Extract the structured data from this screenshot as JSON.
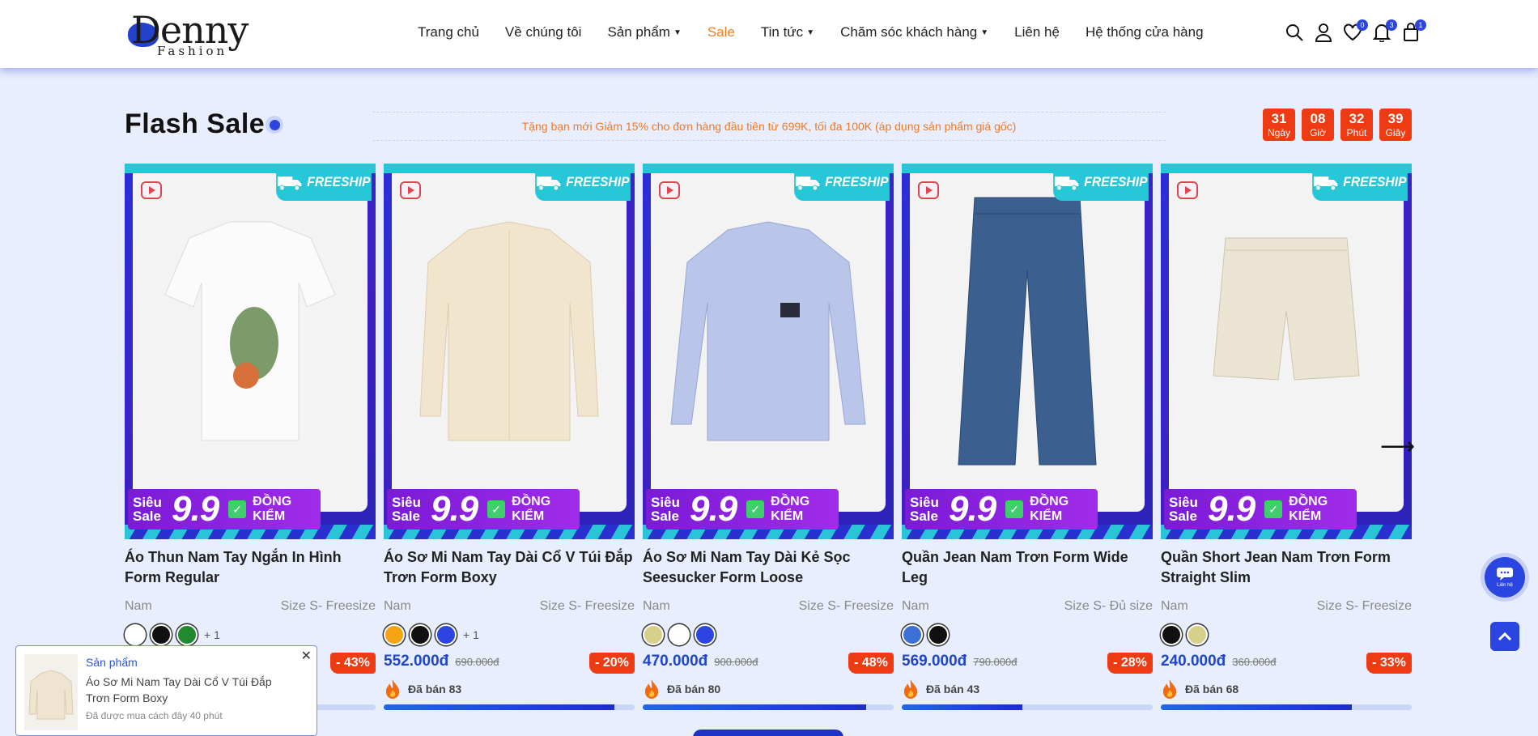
{
  "header": {
    "logo_text": "Denny",
    "logo_sub": "Fashion",
    "nav": [
      {
        "label": "Trang chủ",
        "caret": false
      },
      {
        "label": "Về chúng tôi",
        "caret": false
      },
      {
        "label": "Sản phẩm",
        "caret": true
      },
      {
        "label": "Sale",
        "caret": false
      },
      {
        "label": "Tin tức",
        "caret": true
      },
      {
        "label": "Chăm sóc khách hàng",
        "caret": true
      },
      {
        "label": "Liên hệ",
        "caret": false
      },
      {
        "label": "Hệ thống cửa hàng",
        "caret": false
      }
    ],
    "icons": {
      "search": "search-icon",
      "account": "user-icon",
      "wishlist": "heart-icon",
      "notifications": "bell-icon",
      "cart": "cart-icon"
    },
    "badges": {
      "wishlist": "0",
      "notifications": "3",
      "cart": "1"
    }
  },
  "flash_sale": {
    "title": "Flash Sale",
    "promo": "Tặng bạn mới Giảm 15% cho đơn hàng đầu tiên từ 699K, tối đa 100K (áp dụng sản phẩm giá gốc)",
    "countdown": [
      {
        "value": "31",
        "label": "Ngày"
      },
      {
        "value": "08",
        "label": "Giờ"
      },
      {
        "value": "32",
        "label": "Phút"
      },
      {
        "value": "39",
        "label": "Giây"
      }
    ]
  },
  "badge_texts": {
    "freeship": "FREESHIP",
    "sieu": "Siêu",
    "sale": "Sale",
    "num": "9.9",
    "dong": "ĐỒNG",
    "kiem": "KIỂM"
  },
  "products": [
    {
      "name": "Áo Thun Nam Tay Ngắn In Hình Form Regular",
      "gender": "Nam",
      "size": "Size S- Freesize",
      "colors": [
        "#ffffff",
        "#111111",
        "#1f8a2e"
      ],
      "more": "+ 1",
      "price": "",
      "old_price": "",
      "discount": "- 43%",
      "sold": "",
      "progress": 0.0
    },
    {
      "name": "Áo Sơ Mi Nam Tay Dài Cổ V Túi Đắp Trơn Form Boxy",
      "gender": "Nam",
      "size": "Size S- Freesize",
      "colors": [
        "#f5a313",
        "#111111",
        "#2d45e0"
      ],
      "more": "+ 1",
      "price": "552.000đ",
      "old_price": "690.000đ",
      "discount": "- 20%",
      "sold": "Đã bán 83",
      "progress": 0.92
    },
    {
      "name": "Áo Sơ Mi Nam Tay Dài Kẻ Sọc Seesucker Form Loose",
      "gender": "Nam",
      "size": "Size S- Freesize",
      "colors": [
        "#d7cf8a",
        "#ffffff",
        "#2d45e0"
      ],
      "more": "",
      "price": "470.000đ",
      "old_price": "900.000đ",
      "discount": "- 48%",
      "sold": "Đã bán 80",
      "progress": 0.89
    },
    {
      "name": "Quần Jean Nam Trơn Form Wide Leg",
      "gender": "Nam",
      "size": "Size S- Đủ size",
      "colors": [
        "#3d6fd6",
        "#111111"
      ],
      "more": "",
      "price": "569.000đ",
      "old_price": "790.000đ",
      "discount": "- 28%",
      "sold": "Đã bán 43",
      "progress": 0.48
    },
    {
      "name": "Quần Short Jean Nam Trơn Form Straight Slim",
      "gender": "Nam",
      "size": "Size S- Freesize",
      "colors": [
        "#111111",
        "#d7cf8a"
      ],
      "more": "",
      "price": "240.000đ",
      "old_price": "360.000đ",
      "discount": "- 33%",
      "sold": "Đã bán 68",
      "progress": 0.76
    }
  ],
  "toast": {
    "category": "Sản phẩm",
    "name": "Áo Sơ Mi Nam Tay Dài Cổ V Túi Đắp Trơn Form Boxy",
    "time": "Đã được mua cách đây 40 phút"
  },
  "chat_label": "Liên hệ"
}
